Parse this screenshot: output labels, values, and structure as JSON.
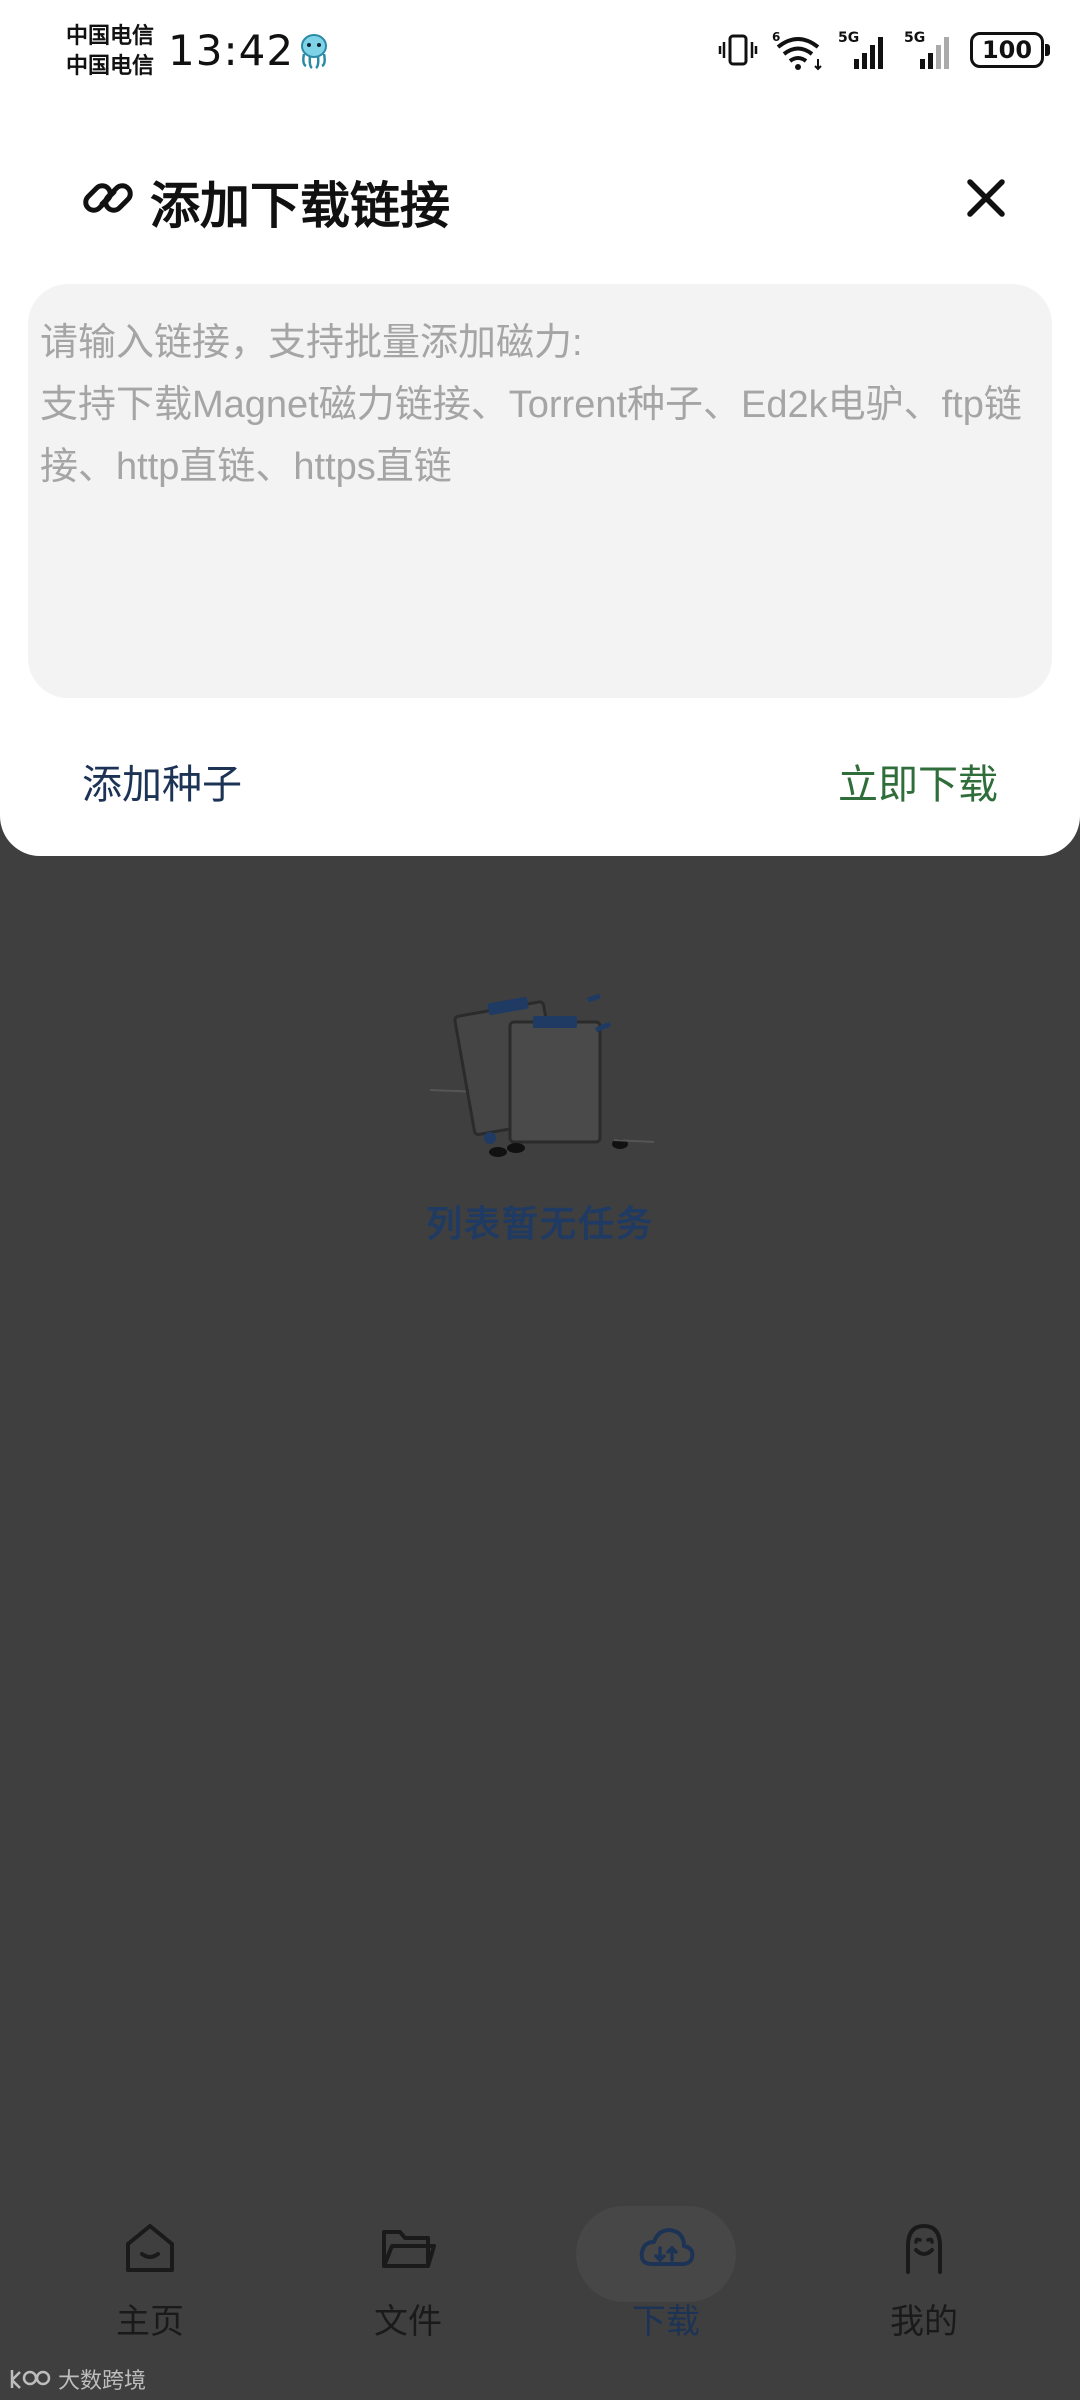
{
  "status_bar": {
    "carrier_1": "中国电信",
    "carrier_2": "中国电信",
    "time": "13:42",
    "signal_1_label": "5G",
    "signal_2_label": "5G",
    "wifi_label": "6",
    "battery": "100"
  },
  "dialog": {
    "title": "添加下载链接",
    "input_placeholder": "请输入链接，支持批量添加磁力:\n支持下载Magnet磁力链接、Torrent种子、Ed2k电驴、ftp链接、http直链、https直链",
    "input_value": "",
    "add_seed_label": "添加种子",
    "download_now_label": "立即下载"
  },
  "main": {
    "empty_text": "列表暂无任务"
  },
  "bottom_nav": {
    "items": [
      {
        "label": "主页",
        "icon": "home-icon"
      },
      {
        "label": "文件",
        "icon": "folder-icon"
      },
      {
        "label": "下载",
        "icon": "cloud-download-icon",
        "active": true
      },
      {
        "label": "我的",
        "icon": "profile-icon"
      }
    ]
  },
  "watermark": "大数跨境",
  "colors": {
    "overlay": "#3f3f3f",
    "dialog_bg": "#ffffff",
    "input_bg": "#f3f3f3",
    "accent_blue": "#1c3356",
    "accent_green": "#2f6e3a"
  }
}
